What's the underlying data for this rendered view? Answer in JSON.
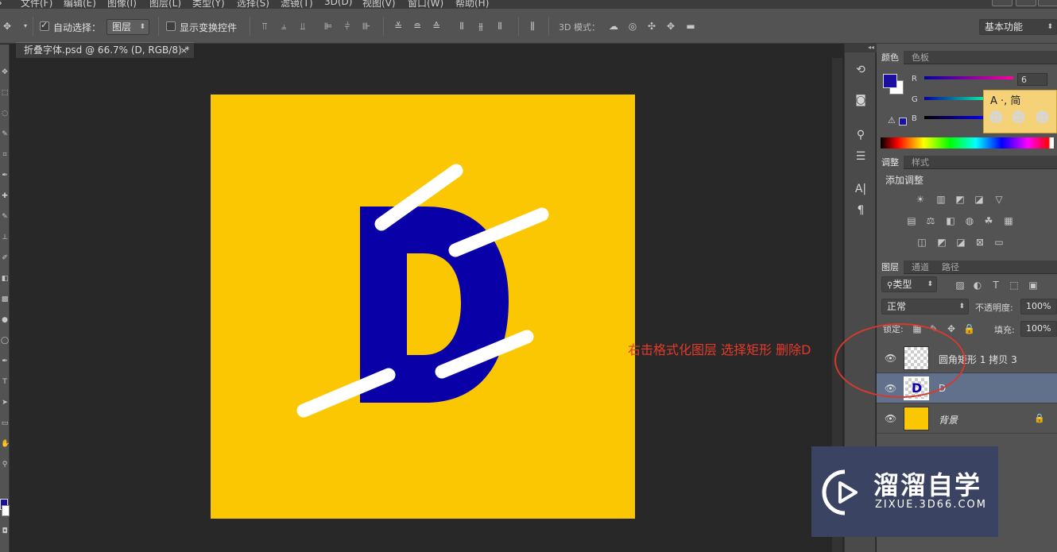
{
  "menubar": {
    "items": [
      "文件(F)",
      "编辑(E)",
      "图像(I)",
      "图层(L)",
      "类型(Y)",
      "选择(S)",
      "滤镜(T)",
      "3D(D)",
      "视图(V)",
      "窗口(W)",
      "帮助(H)"
    ]
  },
  "options": {
    "auto_select_label": "自动选择：",
    "auto_select_checked": true,
    "auto_select_target": "图层",
    "transform_controls_label": "显示变换控件",
    "transform_controls_checked": false,
    "mode_3d_label": "3D 模式：",
    "workspace": "基本功能"
  },
  "document": {
    "tab_title": "折叠字体.psd @ 66.7% (D, RGB/8) *",
    "background_color": "#fbc703",
    "letter": "D",
    "letter_color": "#0a00a8",
    "stripe_color": "#ffffff"
  },
  "color_panel": {
    "tabs": [
      "颜色",
      "色板"
    ],
    "active_tab": "颜色",
    "foreground_color": "#1a0fa0",
    "r_label": "R",
    "g_label": "G",
    "b_label": "B",
    "r_value": "6"
  },
  "adjust_panel": {
    "tabs": [
      "调整",
      "样式"
    ],
    "active_tab": "调整",
    "heading": "添加调整"
  },
  "layers_panel": {
    "tabs": [
      "图层",
      "通道",
      "路径"
    ],
    "active_tab": "图层",
    "filter_kind": "类型",
    "blend_mode": "正常",
    "opacity_label": "不透明度:",
    "opacity_value": "100%",
    "lock_label": "锁定:",
    "fill_label": "填充:",
    "fill_value": "100%",
    "layers": [
      {
        "name": "圆角矩形 1 拷贝 3",
        "selected": false,
        "thumb": "transparent"
      },
      {
        "name": "D",
        "selected": true,
        "thumb": "letter"
      },
      {
        "name": "背景",
        "selected": false,
        "thumb": "fill",
        "locked": true
      }
    ]
  },
  "annotation": {
    "text": "右击格式化图层 选择矩形 删除D",
    "color": "#e53a2a"
  },
  "watermark": {
    "brand": "溜溜自学",
    "url": "ZIXUE.3D66.COM"
  },
  "sticker": {
    "text": "A ·, 简"
  }
}
